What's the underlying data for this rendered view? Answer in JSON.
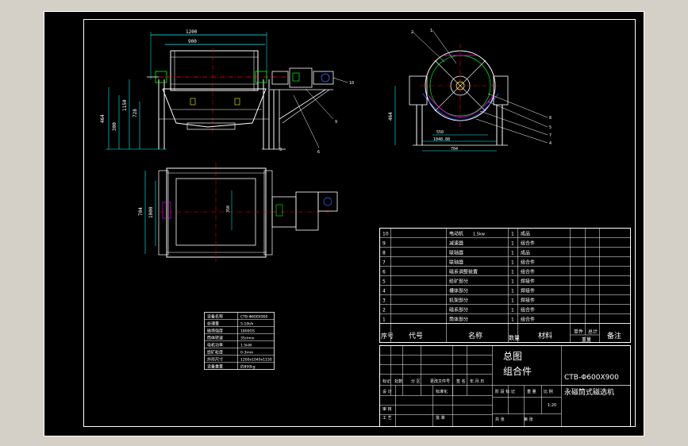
{
  "drawing": {
    "dims": {
      "width_total": "1200",
      "width_drum": "900",
      "height_total": "1150",
      "dim_728": "728",
      "dim_464": "464",
      "dim_300": "300",
      "dim_1040": "1040",
      "dim_550": "550",
      "dim_1048": "1048.88",
      "dim_704": "704",
      "dim_464b": "464",
      "dim_704b": "704",
      "dim_1000": "1000",
      "dim_350": "350",
      "dim_360": "360"
    },
    "balloons": [
      "1",
      "2",
      "3",
      "4",
      "5",
      "6",
      "7",
      "8",
      "9",
      "10"
    ],
    "spec_table": [
      "设备名称",
      "处理量",
      "磁场强度",
      "筒体转速",
      "电机功率",
      "给矿粒度",
      "外形尺寸",
      "设备重量"
    ],
    "spec_values": [
      "CTB-Φ600X900",
      "5-10t/h",
      "1800GS",
      "35r/min",
      "1.5kW",
      "0-3mm",
      "1200x1040x1150",
      "约800kg"
    ]
  },
  "bom": {
    "rows": [
      {
        "no": "10",
        "name": "电动机",
        "spec": "1.5kw",
        "qty": "1",
        "material": "成品"
      },
      {
        "no": "9",
        "name": "减速器",
        "spec": "",
        "qty": "1",
        "material": "组合件"
      },
      {
        "no": "8",
        "name": "联轴器",
        "spec": "",
        "qty": "1",
        "material": "成品"
      },
      {
        "no": "7",
        "name": "联轴器",
        "spec": "",
        "qty": "1",
        "material": "组合件"
      },
      {
        "no": "6",
        "name": "磁系调整装置",
        "spec": "",
        "qty": "1",
        "material": "组合件"
      },
      {
        "no": "5",
        "name": "给矿部分",
        "spec": "",
        "qty": "1",
        "material": "焊接件"
      },
      {
        "no": "4",
        "name": "槽体部分",
        "spec": "",
        "qty": "1",
        "material": "焊接件"
      },
      {
        "no": "3",
        "name": "机架部分",
        "spec": "",
        "qty": "1",
        "material": "焊接件"
      },
      {
        "no": "2",
        "name": "磁系部分",
        "spec": "",
        "qty": "1",
        "material": "组合件"
      },
      {
        "no": "1",
        "name": "筒体部分",
        "spec": "",
        "qty": "1",
        "material": "组合件"
      }
    ],
    "header": {
      "no": "序号",
      "code": "代号",
      "name": "名称",
      "qty": "数量",
      "material": "材料",
      "unit": "单件",
      "total": "总计",
      "weight": "重量",
      "remark": "备注"
    }
  },
  "title_block": {
    "title1": "总图",
    "title2": "组合件",
    "code": "CTB-Φ600X900",
    "name": "永磁筒式磁选机",
    "scale": "1:20",
    "labels": {
      "mark": "标记",
      "count": "处数",
      "zone": "分 区",
      "change_doc": "更改文件号",
      "sign": "签 名",
      "date": "年.月.日",
      "design": "设 计",
      "standard": "标准化",
      "stage": "阶 段 标 记",
      "weight": "重 量",
      "ratio": "比 例",
      "audit": "审 核",
      "craft": "工 艺",
      "approve": "批 准",
      "total_sheets": "共    张",
      "sheet_no": "第    张"
    }
  },
  "colors": {
    "background": "#d4d0c8",
    "paper": "#000000",
    "line": "#ffffff",
    "cyan": "#00ffff",
    "red": "#ff0000",
    "magenta": "#ff00ff",
    "yellow": "#ffff00",
    "green": "#00ff00",
    "blue": "#4060ff"
  }
}
